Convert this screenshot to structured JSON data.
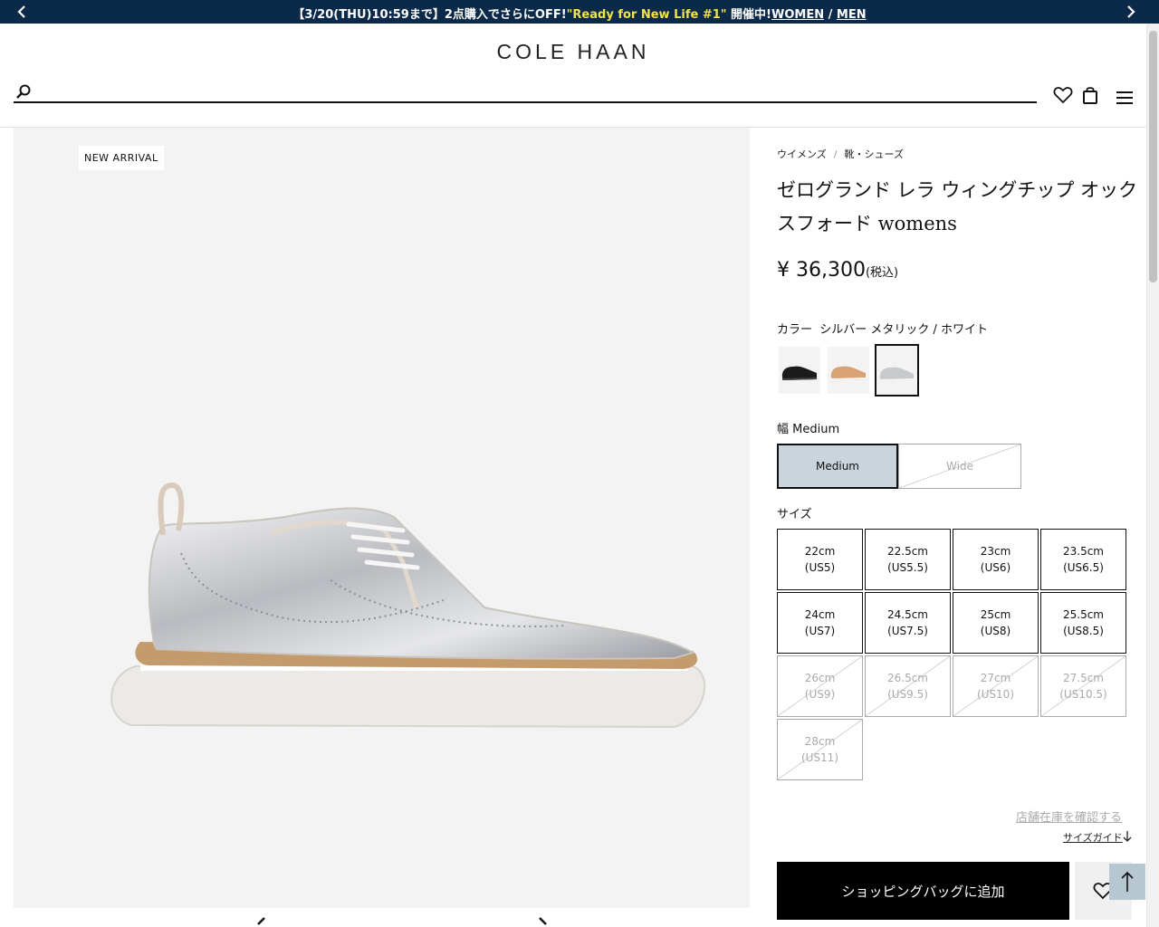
{
  "promo": {
    "text_main": "【3/20(THU)10:59まで】2点購入でさらにOFF!",
    "text_highlight": "\"Ready for New Life #1\"",
    "text_event": " 開催中!",
    "link_women": "WOMEN",
    "separator": " / ",
    "link_men": "MEN"
  },
  "header": {
    "logo": "COLE HAAN",
    "search_value": ""
  },
  "gallery": {
    "badge": "NEW ARRIVAL"
  },
  "breadcrumb": {
    "items": [
      "ウイメンズ",
      "靴・シューズ"
    ],
    "separator": "/"
  },
  "product": {
    "title": "ゼログランド レラ ウィングチップ オックスフォード womens",
    "price": "¥ 36,300",
    "tax_note": "(税込)",
    "color_label": "カラー",
    "color_value": "シルバー メタリック / ホワイト",
    "width_label": "幅",
    "width_value": "Medium",
    "widths": [
      {
        "label": "Medium",
        "selected": true,
        "available": true
      },
      {
        "label": "Wide",
        "selected": false,
        "available": false
      }
    ],
    "size_label": "サイズ",
    "sizes": [
      {
        "jp": "22cm",
        "us": "(US5)",
        "available": true
      },
      {
        "jp": "22.5cm",
        "us": "(US5.5)",
        "available": true
      },
      {
        "jp": "23cm",
        "us": "(US6)",
        "available": true
      },
      {
        "jp": "23.5cm",
        "us": "(US6.5)",
        "available": true
      },
      {
        "jp": "24cm",
        "us": "(US7)",
        "available": true
      },
      {
        "jp": "24.5cm",
        "us": "(US7.5)",
        "available": true
      },
      {
        "jp": "25cm",
        "us": "(US8)",
        "available": true
      },
      {
        "jp": "25.5cm",
        "us": "(US8.5)",
        "available": true
      },
      {
        "jp": "26cm",
        "us": "(US9)",
        "available": false
      },
      {
        "jp": "26.5cm",
        "us": "(US9.5)",
        "available": false
      },
      {
        "jp": "27cm",
        "us": "(US10)",
        "available": false
      },
      {
        "jp": "27.5cm",
        "us": "(US10.5)",
        "available": false
      },
      {
        "jp": "28cm",
        "us": "(US11)",
        "available": false
      }
    ],
    "store_stock_link": "店舗在庫を確認する",
    "size_guide_link": "サイズガイド",
    "add_to_bag": "ショッピングバッグに追加"
  },
  "colors": {
    "promo_bg": "#0b2a4a",
    "promo_highlight": "#f3e24a",
    "selected_width_bg": "#c9d4dc",
    "to_top_bg": "#b6c7d2"
  }
}
